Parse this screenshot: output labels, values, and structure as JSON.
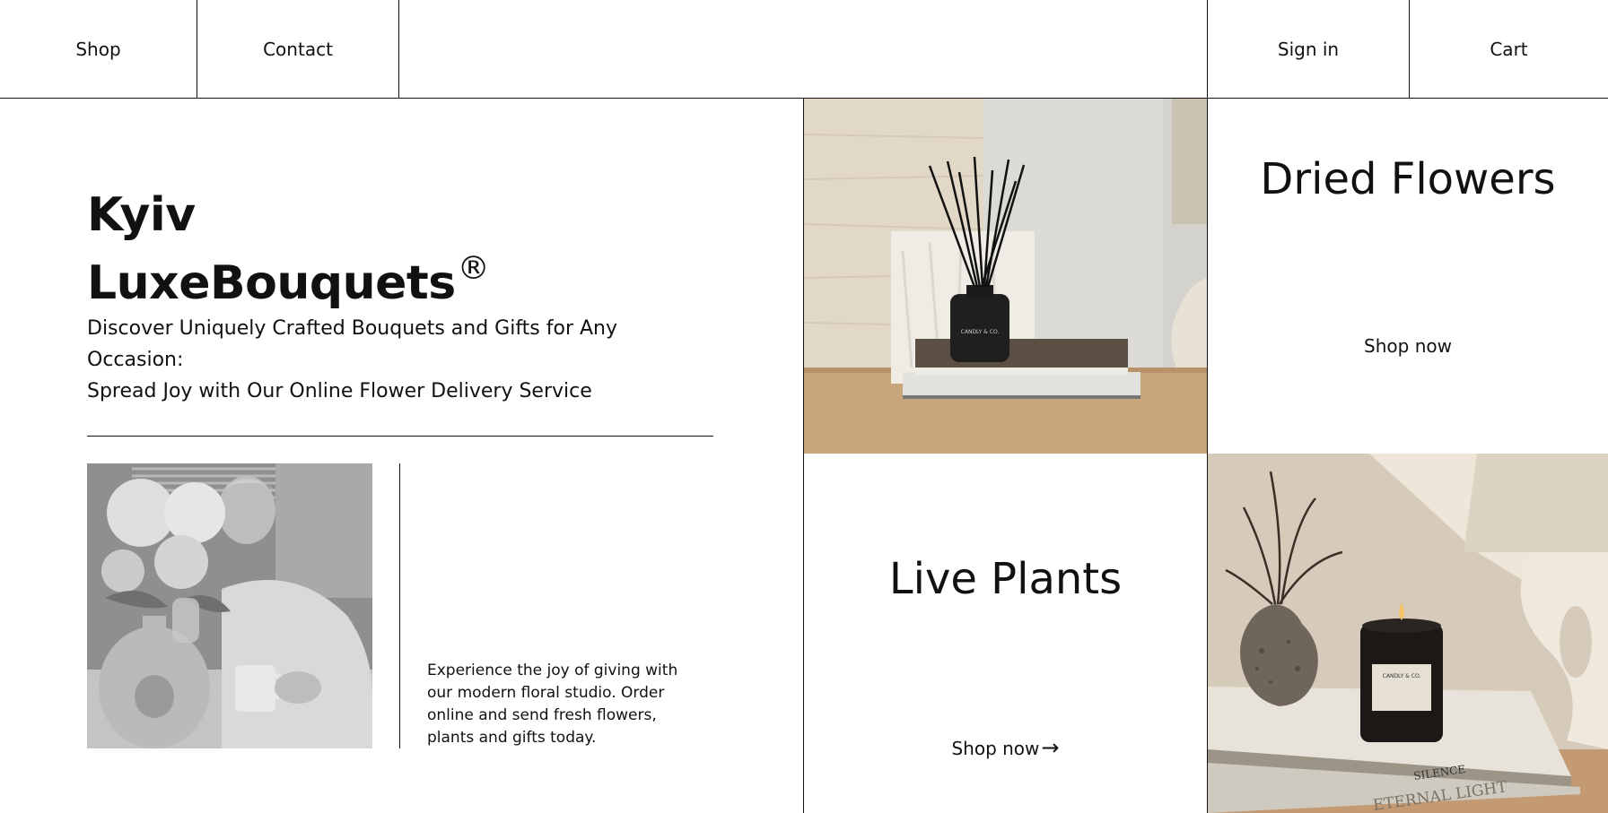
{
  "nav": {
    "shop": "Shop",
    "contact": "Contact",
    "sign_in": "Sign in",
    "cart": "Cart"
  },
  "hero": {
    "title_line1": "Kyiv",
    "title_line2": "LuxeBouquets",
    "registered_mark": "®",
    "subtitle_line1": "Discover Uniquely Crafted Bouquets and Gifts for Any Occasion:",
    "subtitle_line2": "Spread Joy with Our Online Flower Delivery Service",
    "description": "Experience the joy of giving with our modern floral studio. Order online and send fresh flowers, plants and gifts today."
  },
  "categories": {
    "dried": {
      "title": "Dried Flowers",
      "cta": "Shop now"
    },
    "live": {
      "title": "Live Plants",
      "cta": "Shop now",
      "arrow": "→"
    }
  },
  "images": {
    "diffuser_label": "CANDLY & CO.",
    "candle_label": "CANDLY & CO.",
    "book_spine_1": "SILENCE",
    "book_spine_2": "ETERNAL LIGHT"
  },
  "colors": {
    "ink": "#111111",
    "background": "#ffffff",
    "wood": "#c9a57c",
    "stone": "#d9d1c3"
  }
}
